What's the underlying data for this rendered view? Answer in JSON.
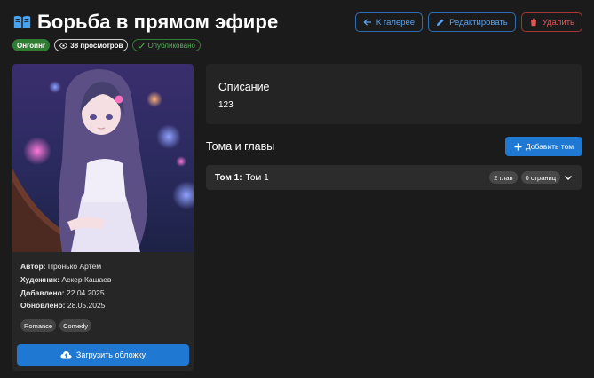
{
  "header": {
    "title": "Борьба в прямом эфире",
    "title_icon": "book-open-icon"
  },
  "badges": {
    "status": "Онгоинг",
    "views": "38 просмотров",
    "published": "Опубликовано"
  },
  "actions": {
    "back": "К галерее",
    "edit": "Редактировать",
    "delete": "Удалить"
  },
  "info": {
    "author_label": "Автор:",
    "author": "Пронько Артем",
    "artist_label": "Художник:",
    "artist": "Аскер Кашаев",
    "added_label": "Добавлено:",
    "added": "22.04.2025",
    "updated_label": "Обновлено:",
    "updated": "28.05.2025"
  },
  "tags": [
    "Romance",
    "Comedy"
  ],
  "upload_cover": "Загрузить обложку",
  "description": {
    "title": "Описание",
    "text": "123"
  },
  "volumes": {
    "heading": "Тома и главы",
    "add_button": "Добавить том",
    "items": [
      {
        "number": "Том 1:",
        "name": "Том 1",
        "chapters": "2 глав",
        "pages": "0 страниц"
      }
    ]
  },
  "colors": {
    "background": "#1b1b1b",
    "card": "#262626",
    "accent": "#1f78d1",
    "status_green": "#2e7d32",
    "danger": "#e05555"
  }
}
